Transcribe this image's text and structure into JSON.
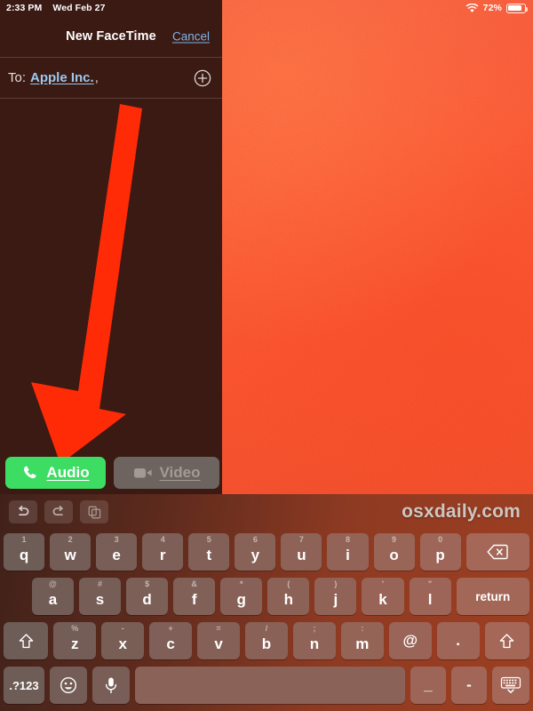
{
  "statusbar": {
    "time": "2:33 PM",
    "date": "Wed Feb 27",
    "battery_percent": "72%",
    "wifi_icon": "wifi-icon",
    "battery_icon": "battery-icon",
    "battery_level": 72
  },
  "header": {
    "title": "New FaceTime",
    "cancel_label": "Cancel"
  },
  "recipients": {
    "to_label": "To:",
    "token": "Apple Inc.",
    "separator": ",",
    "add_icon": "add-contact-icon"
  },
  "actions": {
    "audio_label": "Audio",
    "audio_icon": "phone-icon",
    "audio_color": "#3ddc63",
    "video_label": "Video",
    "video_icon": "video-camera-icon",
    "video_color": "#6d6460",
    "video_disabled": true
  },
  "annotation": {
    "type": "arrow",
    "color": "#ff2b06",
    "points_to": "Audio"
  },
  "keyboard": {
    "toolbar": {
      "undo_icon": "undo-icon",
      "redo_icon": "redo-icon",
      "paste_icon": "paste-icon",
      "watermark": "osxdaily.com"
    },
    "row1": [
      {
        "main": "q",
        "hint": "1"
      },
      {
        "main": "w",
        "hint": "2"
      },
      {
        "main": "e",
        "hint": "3"
      },
      {
        "main": "r",
        "hint": "4"
      },
      {
        "main": "t",
        "hint": "5"
      },
      {
        "main": "y",
        "hint": "6"
      },
      {
        "main": "u",
        "hint": "7"
      },
      {
        "main": "i",
        "hint": "8"
      },
      {
        "main": "o",
        "hint": "9"
      },
      {
        "main": "p",
        "hint": "0"
      }
    ],
    "row1_backspace_icon": "backspace-icon",
    "row2": [
      {
        "main": "a",
        "hint": "@"
      },
      {
        "main": "s",
        "hint": "#"
      },
      {
        "main": "d",
        "hint": "$"
      },
      {
        "main": "f",
        "hint": "&"
      },
      {
        "main": "g",
        "hint": "*"
      },
      {
        "main": "h",
        "hint": "("
      },
      {
        "main": "j",
        "hint": ")"
      },
      {
        "main": "k",
        "hint": "'"
      },
      {
        "main": "l",
        "hint": "\""
      }
    ],
    "row2_return_label": "return",
    "row3": [
      {
        "main": "z",
        "hint": "%"
      },
      {
        "main": "x",
        "hint": "-"
      },
      {
        "main": "c",
        "hint": "+"
      },
      {
        "main": "v",
        "hint": "="
      },
      {
        "main": "b",
        "hint": "/"
      },
      {
        "main": "n",
        "hint": ";"
      },
      {
        "main": "m",
        "hint": ":"
      }
    ],
    "row3_at_label": "@",
    "row3_period_label": ".",
    "row3_shift_icon": "shift-icon",
    "row4": {
      "numeric_label": ".?123",
      "emoji_icon": "emoji-icon",
      "mic_icon": "microphone-icon",
      "space_label": "",
      "underscore_label": "_",
      "dash_label": "-",
      "dismiss_icon": "keyboard-dismiss-icon"
    }
  }
}
